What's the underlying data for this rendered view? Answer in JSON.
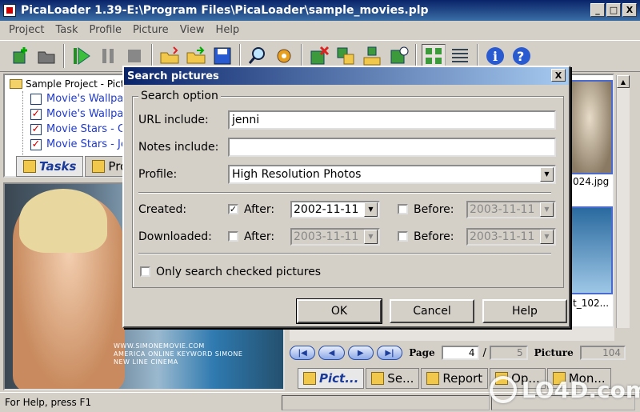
{
  "app": {
    "title": "PicaLoader 1.39-E:\\Program Files\\PicaLoader\\sample_movies.plp",
    "window_buttons": [
      "_",
      "□",
      "X"
    ]
  },
  "menu": [
    "Project",
    "Task",
    "Profile",
    "Picture",
    "View",
    "Help"
  ],
  "toolbar_icons": [
    "new-project-icon",
    "open-project-icon",
    "start-icon",
    "pause-icon",
    "stop-icon",
    "open-folder-icon",
    "export-icon",
    "save-icon",
    "search-icon",
    "settings-icon",
    "delete-icon",
    "copy-icon",
    "move-icon",
    "refresh-icon",
    "thumbnails-view-icon",
    "details-view-icon",
    "info-icon",
    "help-icon"
  ],
  "tree": {
    "root": "Sample Project - Pict",
    "items": [
      {
        "label": "Movie's Wallpape",
        "checked": false
      },
      {
        "label": "Movie's Wallpape",
        "checked": true
      },
      {
        "label": "Movie Stars - Ca",
        "checked": true
      },
      {
        "label": "Movie Stars - Je",
        "checked": true
      }
    ]
  },
  "left_tabs": [
    "Tasks",
    "Pro"
  ],
  "preview": {
    "promo_line1": "WWW.SIMONEMOVIE.COM",
    "promo_line2": "AMERICA ONLINE KEYWORD SIMONE",
    "promo_line3": "NEW LINE CINEMA"
  },
  "thumbnails": [
    {
      "label": "024.jpg"
    },
    {
      "label": "t_102..."
    }
  ],
  "pager": {
    "first": "|◀",
    "prev": "◀",
    "next": "▶",
    "last": "▶|",
    "page_label": "Page",
    "page_value": "4",
    "separator": "/",
    "page_total": "5",
    "picture_label": "Picture",
    "picture_value": "104"
  },
  "bottom_tabs": [
    "Pict...",
    "Se...",
    "Report",
    "Op...",
    "Mon..."
  ],
  "status": {
    "text": "For Help, press F1"
  },
  "watermark": "LO4D.com",
  "dialog": {
    "title": "Search pictures",
    "close": "X",
    "group_label": "Search option",
    "url_label": "URL include:",
    "url_value": "jenni",
    "notes_label": "Notes include:",
    "notes_value": "",
    "profile_label": "Profile:",
    "profile_value": "High Resolution Photos",
    "created_label": "Created:",
    "downloaded_label": "Downloaded:",
    "after_label": "After:",
    "before_label": "Before:",
    "created_after_checked": true,
    "created_after_date": "2002-11-11",
    "created_before_date": "2003-11-11",
    "downloaded_after_date": "2003-11-11",
    "downloaded_before_date": "2003-11-11",
    "only_checked_label": "Only search checked pictures",
    "ok": "OK",
    "cancel": "Cancel",
    "help": "Help"
  }
}
